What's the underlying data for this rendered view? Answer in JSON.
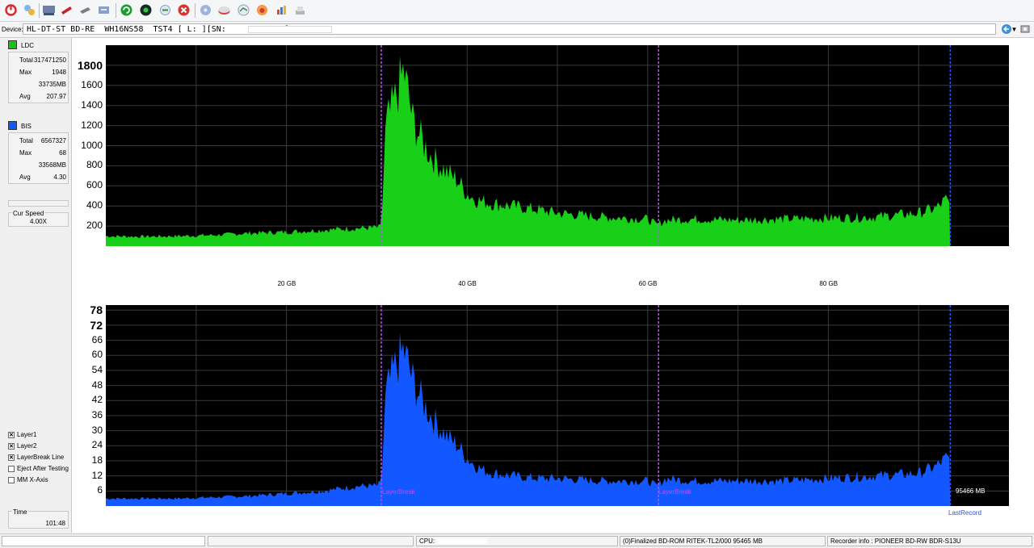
{
  "toolbar": {
    "buttons": [
      "power-icon",
      "device-icon",
      "drive-icon",
      "disc-icon",
      "eject-icon",
      "save-icon",
      "start-icon",
      "globe-icon",
      "refresh-icon",
      "stop-icon",
      "blank-icon",
      "erase-icon",
      "compare-icon",
      "flame-icon",
      "chart-icon",
      "settings-icon"
    ]
  },
  "device": {
    "label": "Device:",
    "value": "HL-DT-ST BD-RE  WH16NS58  TST4 [ L: ][SN:            ]"
  },
  "ldc": {
    "name": "LDC",
    "color": "#16c416",
    "rows": [
      {
        "k": "Total",
        "v": "317471250"
      },
      {
        "k": "Max",
        "v": "1948"
      },
      {
        "k": "",
        "v": "33735MB"
      },
      {
        "k": "Avg",
        "v": "207.97"
      }
    ]
  },
  "bis": {
    "name": "BIS",
    "color": "#1256ff",
    "rows": [
      {
        "k": "Total",
        "v": "6567327"
      },
      {
        "k": "Max",
        "v": "68"
      },
      {
        "k": "",
        "v": "33568MB"
      },
      {
        "k": "Avg",
        "v": "4.30"
      }
    ]
  },
  "speed": {
    "title": "Cur Speed",
    "value": "4.00X"
  },
  "options": [
    {
      "label": "Layer1",
      "checked": true
    },
    {
      "label": "Layer2",
      "checked": true
    },
    {
      "label": "LayerBreak Line",
      "checked": true
    },
    {
      "label": "Eject After Testing",
      "checked": false
    },
    {
      "label": "MM X-Axis",
      "checked": false
    }
  ],
  "time": {
    "title": "Time",
    "value": "101:48"
  },
  "chart_data": [
    {
      "type": "area",
      "series": [
        {
          "name": "LDC",
          "color": "#18d018"
        }
      ],
      "x": [
        0,
        4,
        8,
        12,
        16,
        20,
        24,
        26,
        28,
        30,
        30.5,
        31,
        32,
        33,
        34,
        35,
        36,
        37,
        38,
        39,
        40,
        41,
        42,
        43,
        45,
        48,
        50,
        55,
        60,
        61,
        62,
        65,
        70,
        75,
        80,
        85,
        90,
        92,
        93,
        93.5
      ],
      "y": [
        100,
        95,
        100,
        110,
        130,
        140,
        160,
        170,
        180,
        185,
        190,
        1200,
        1450,
        1750,
        1250,
        1050,
        900,
        800,
        720,
        650,
        520,
        460,
        440,
        420,
        400,
        360,
        330,
        290,
        270,
        210,
        260,
        270,
        260,
        270,
        280,
        290,
        330,
        380,
        460,
        400
      ],
      "ylim": [
        0,
        2000
      ],
      "yticks": [
        "1800",
        "1600",
        "1400",
        "1200",
        "1000",
        "800",
        "600",
        "400",
        "200"
      ],
      "xticks": [
        "20 GB",
        "40 GB",
        "60 GB",
        "80 GB"
      ],
      "xlim": [
        0,
        100
      ]
    },
    {
      "type": "area",
      "series": [
        {
          "name": "BIS",
          "color": "#1257ff"
        }
      ],
      "x": [
        0,
        4,
        8,
        12,
        16,
        20,
        24,
        26,
        28,
        30,
        30.5,
        31,
        32,
        33,
        34,
        35,
        36,
        37,
        38,
        39,
        40,
        41,
        42,
        43,
        45,
        48,
        50,
        55,
        60,
        61,
        62,
        65,
        70,
        75,
        80,
        85,
        90,
        92,
        93,
        93.5
      ],
      "y": [
        3,
        3,
        3,
        3.5,
        4,
        5,
        6,
        7,
        8,
        8,
        9,
        45,
        55,
        62,
        50,
        42,
        36,
        31,
        27,
        24,
        19,
        16,
        14,
        13,
        12,
        11,
        11,
        10,
        10,
        8,
        11,
        10,
        10,
        10,
        11,
        12,
        13,
        16,
        19,
        18
      ],
      "ylim": [
        0,
        80
      ],
      "yticks": [
        "78",
        "72",
        "66",
        "60",
        "54",
        "48",
        "42",
        "36",
        "30",
        "24",
        "18",
        "12",
        "6"
      ],
      "xticks": [
        "20 GB",
        "40 GB",
        "60 GB",
        "80 GB"
      ],
      "xlim": [
        0,
        100
      ],
      "annotations": {
        "layerbreak1": "LayerBreak",
        "layerbreak2": "LayerBreak",
        "end_value": "95466 MB",
        "last_record": "LastRecord"
      }
    }
  ],
  "status": {
    "cpu": "CPU:",
    "disc": "(0)Finalized   BD-ROM   RITEK-TL2/000   95465 MB",
    "recorder": "Recorder info : PIONEER        BD-RW   BDR-S13U"
  }
}
